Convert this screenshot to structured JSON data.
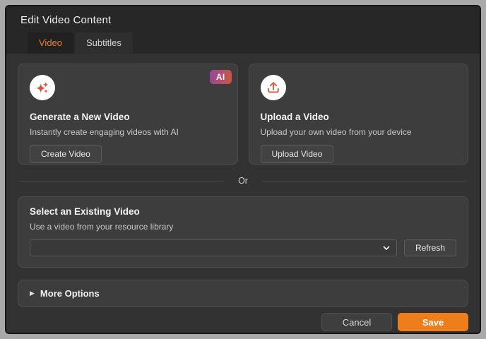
{
  "dialog": {
    "title": "Edit Video Content",
    "tabs": [
      {
        "label": "Video",
        "active": true
      },
      {
        "label": "Subtitles",
        "active": false
      }
    ],
    "cards": {
      "generate": {
        "icon": "sparkles-icon",
        "badge": "AI",
        "title": "Generate a New Video",
        "description": "Instantly create engaging videos with AI",
        "button": "Create Video"
      },
      "upload": {
        "icon": "upload-icon",
        "title": "Upload a Video",
        "description": "Upload your own video from your device",
        "button": "Upload Video"
      }
    },
    "divider_label": "Or",
    "existing": {
      "title": "Select an Existing Video",
      "description": "Use a video from your resource library",
      "select_value": "",
      "select_icon": "chevron-down-icon",
      "refresh_button": "Refresh"
    },
    "more_options": {
      "disclosure_icon": "▶",
      "label": "More Options"
    },
    "footer": {
      "cancel": "Cancel",
      "save": "Save"
    }
  },
  "colors": {
    "accent": "#e8802e",
    "icon": "#d9573c",
    "save": "#ee7e1b",
    "badge_gradient_start": "#8f489e",
    "badge_gradient_end": "#d0563f"
  }
}
